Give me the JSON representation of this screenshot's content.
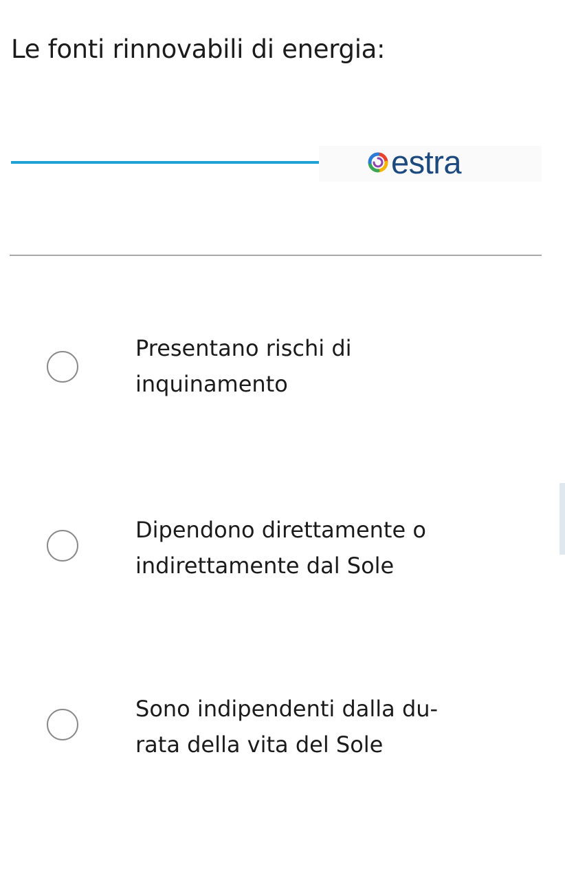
{
  "question": {
    "text": "Le fonti rinnovabili di energia:"
  },
  "brand": {
    "name": "estra",
    "logo_icon": "estra-swirl-icon",
    "line_color": "#1fa3d6",
    "text_color": "#1d4a7e"
  },
  "options": [
    {
      "line1": "Presentano rischi di",
      "line2": "inquinamento",
      "selected": false
    },
    {
      "line1": "Dipendono direttamente o",
      "line2": "indirettamente dal Sole",
      "selected": false
    },
    {
      "line1": "Sono indipendenti dalla du-",
      "line2": "rata della vita del Sole",
      "selected": false
    }
  ]
}
